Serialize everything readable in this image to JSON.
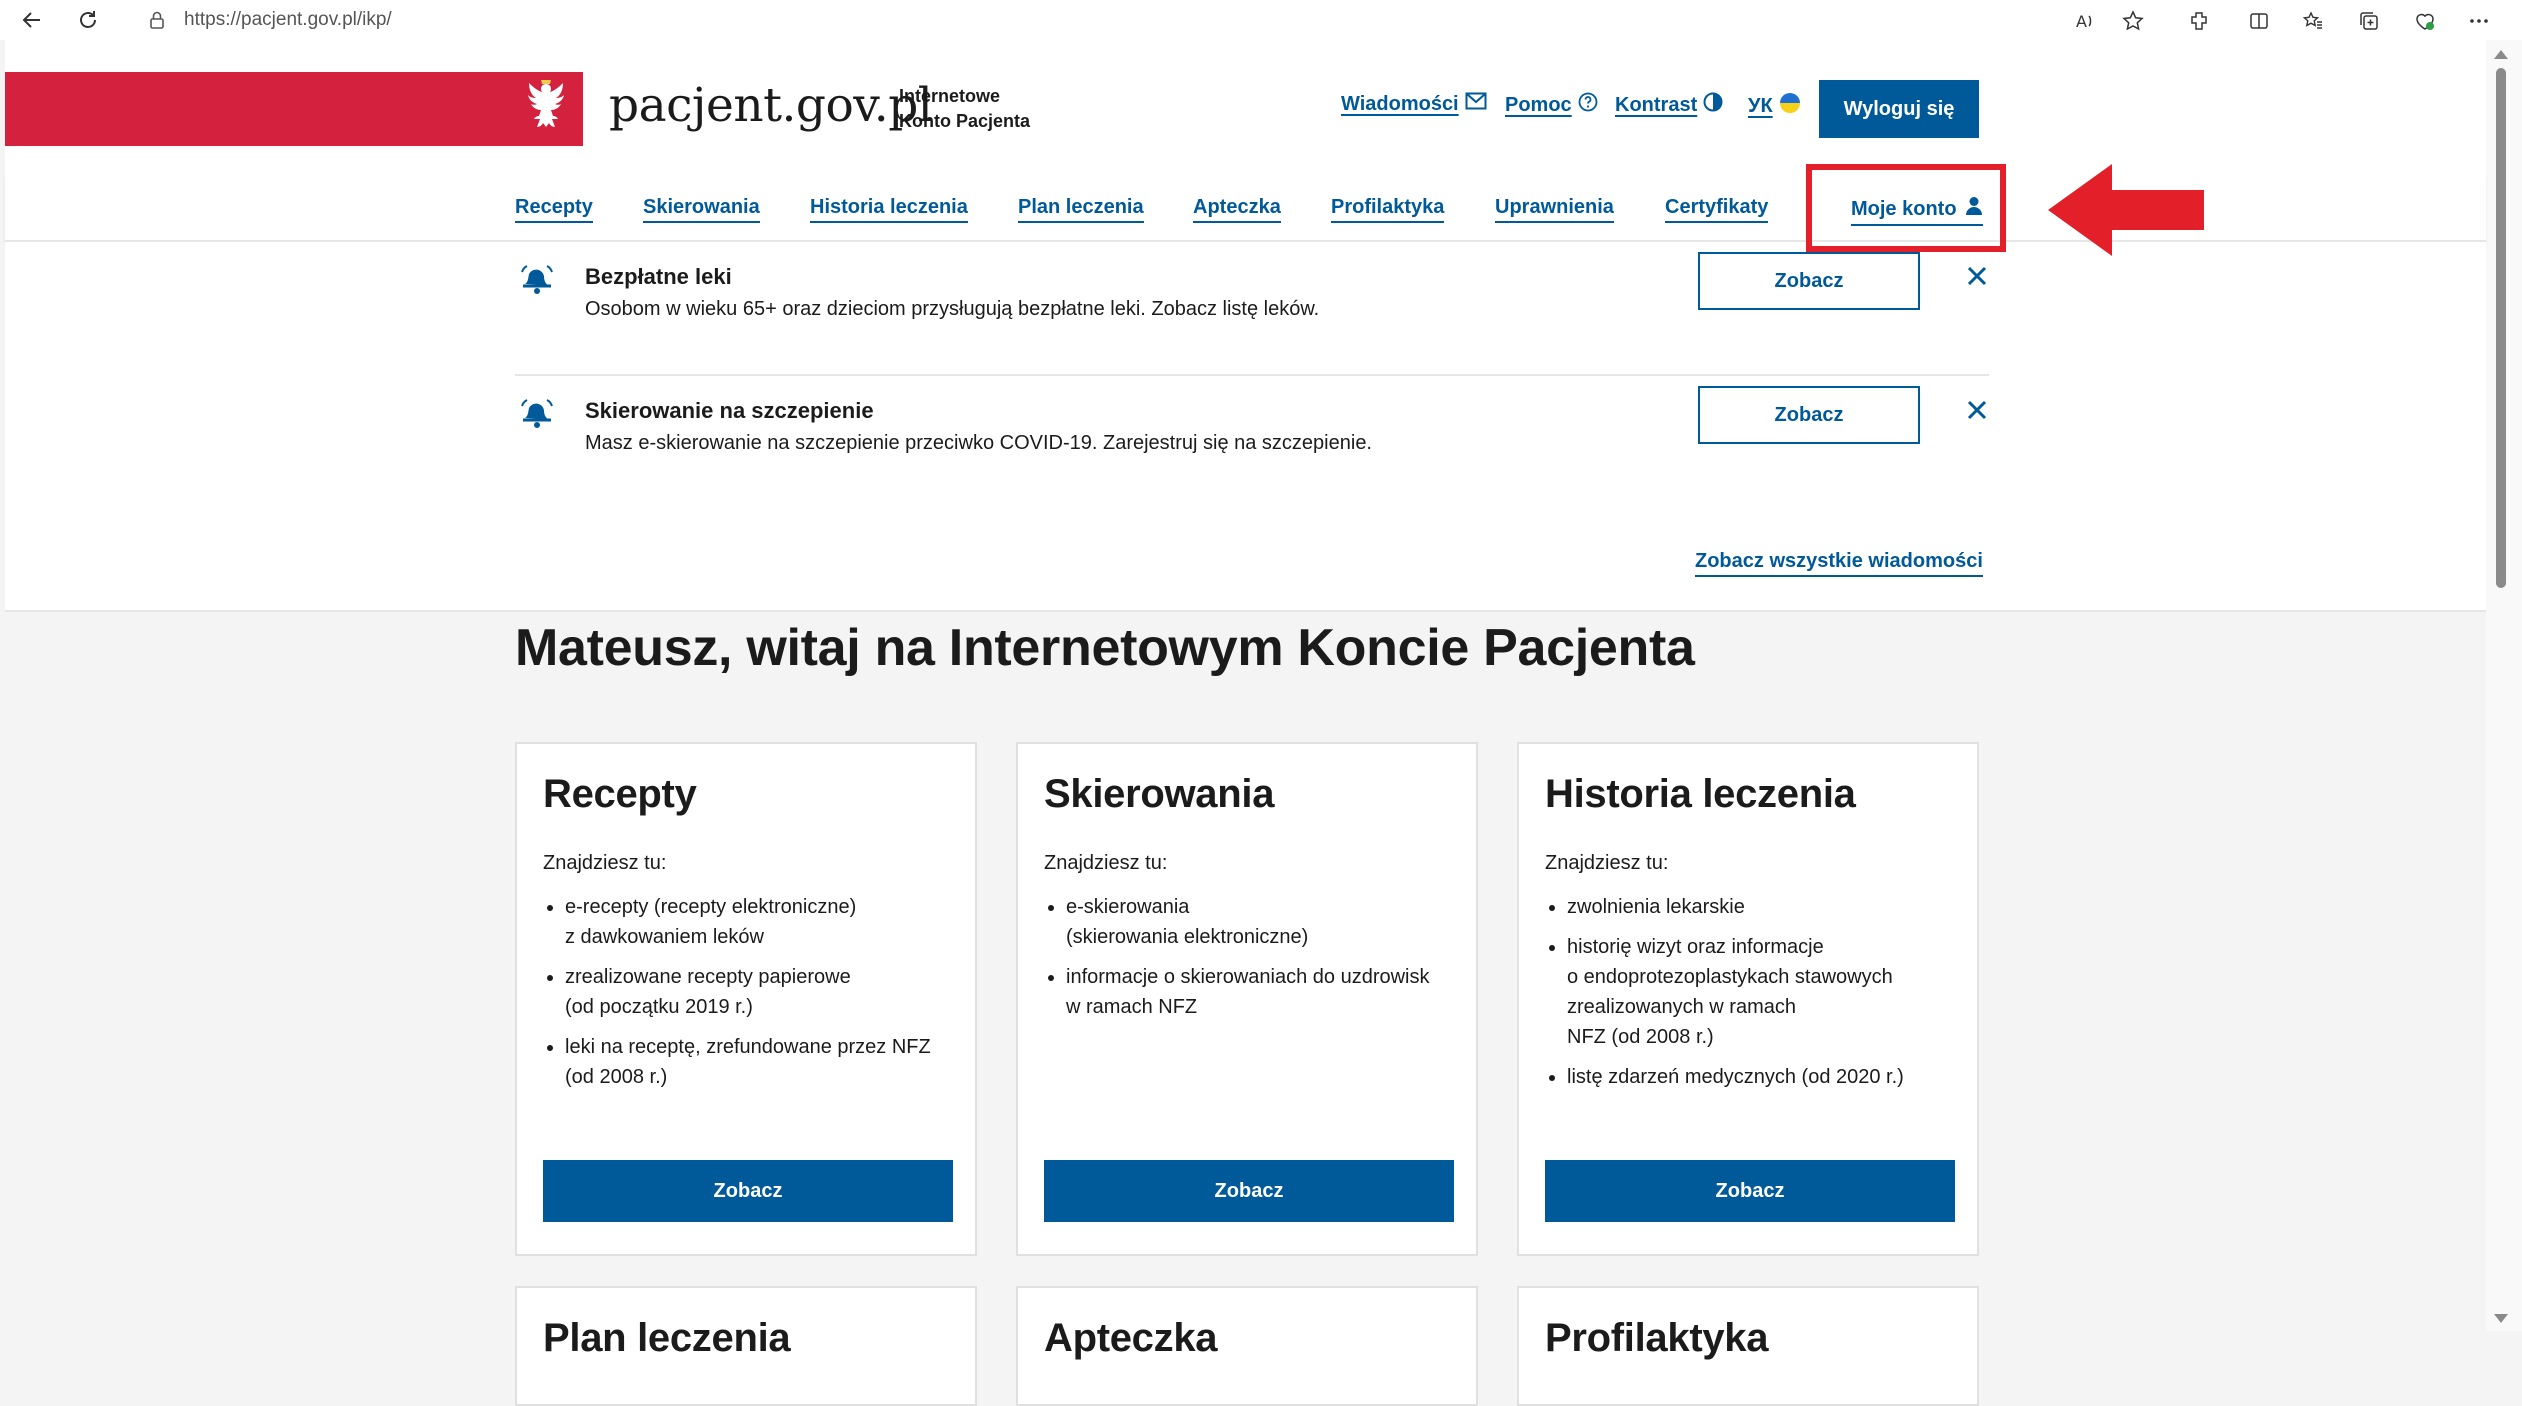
{
  "browser": {
    "url": "https://pacjent.gov.pl/ikp/"
  },
  "header": {
    "logo_text": "pacjent.gov.pl",
    "logo_sub_line1": "Internetowe",
    "logo_sub_line2": "Konto Pacjenta",
    "links": {
      "messages": "Wiadomości",
      "help": "Pomoc",
      "contrast": "Kontrast",
      "language": "УК"
    },
    "logout": "Wyloguj się"
  },
  "nav": {
    "items": [
      "Recepty",
      "Skierowania",
      "Historia leczenia",
      "Plan leczenia",
      "Apteczka",
      "Profilaktyka",
      "Uprawnienia",
      "Certyfikaty",
      "Moje konto"
    ]
  },
  "notices": [
    {
      "title": "Bezpłatne leki",
      "desc": "Osobom w wieku 65+ oraz dzieciom przysługują bezpłatne leki. Zobacz listę leków.",
      "button": "Zobacz"
    },
    {
      "title": "Skierowanie na szczepienie",
      "desc": "Masz e-skierowanie na szczepienie przeciwko COVID-19. Zarejestruj się na szczepienie.",
      "button": "Zobacz"
    }
  ],
  "all_messages_link": "Zobacz wszystkie wiadomości",
  "welcome": "Mateusz, witaj na Internetowym Koncie Pacjenta",
  "cards": [
    {
      "title": "Recepty",
      "intro": "Znajdziesz tu:",
      "items": [
        "e-recepty (recepty elektroniczne)\nz dawkowaniem leków",
        "zrealizowane recepty papierowe\n(od początku 2019 r.)",
        "leki na receptę, zrefundowane przez NFZ\n(od 2008 r.)"
      ],
      "button": "Zobacz"
    },
    {
      "title": "Skierowania",
      "intro": "Znajdziesz tu:",
      "items": [
        "e-skierowania\n(skierowania elektroniczne)",
        "informacje o skierowaniach do uzdrowisk\nw ramach NFZ"
      ],
      "button": "Zobacz"
    },
    {
      "title": "Historia leczenia",
      "intro": "Znajdziesz tu:",
      "items": [
        "zwolnienia lekarskie",
        "historię wizyt oraz informacje\no endoprotezoplastykach stawowych\nzrealizowanych w ramach\nNFZ (od 2008 r.)",
        "listę zdarzeń medycznych (od 2020 r.)"
      ],
      "button": "Zobacz"
    },
    {
      "title": "Plan leczenia"
    },
    {
      "title": "Apteczka"
    },
    {
      "title": "Profilaktyka"
    }
  ],
  "colors": {
    "brand_blue": "#005999",
    "brand_red": "#d4213d",
    "annotation_red": "#e3202a"
  }
}
